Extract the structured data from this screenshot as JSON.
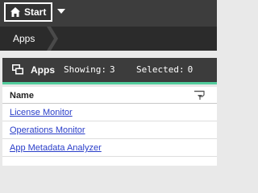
{
  "toolbar": {
    "start_label": "Start",
    "start_icon": "home-icon",
    "menu_icon": "caret-down-icon"
  },
  "breadcrumb": {
    "items": [
      "Apps"
    ]
  },
  "panel": {
    "icon": "apps-icon",
    "title": "Apps",
    "showing_label": "Showing:",
    "showing_count": "3",
    "selected_label": "Selected:",
    "selected_count": "0",
    "accent_color": "#52cc9c"
  },
  "table": {
    "columns": [
      "Name"
    ],
    "filter_icon": "filter-icon",
    "rows": [
      "License Monitor",
      "Operations Monitor",
      "App Metadata Analyzer"
    ],
    "link_color": "#2a3ec9"
  }
}
